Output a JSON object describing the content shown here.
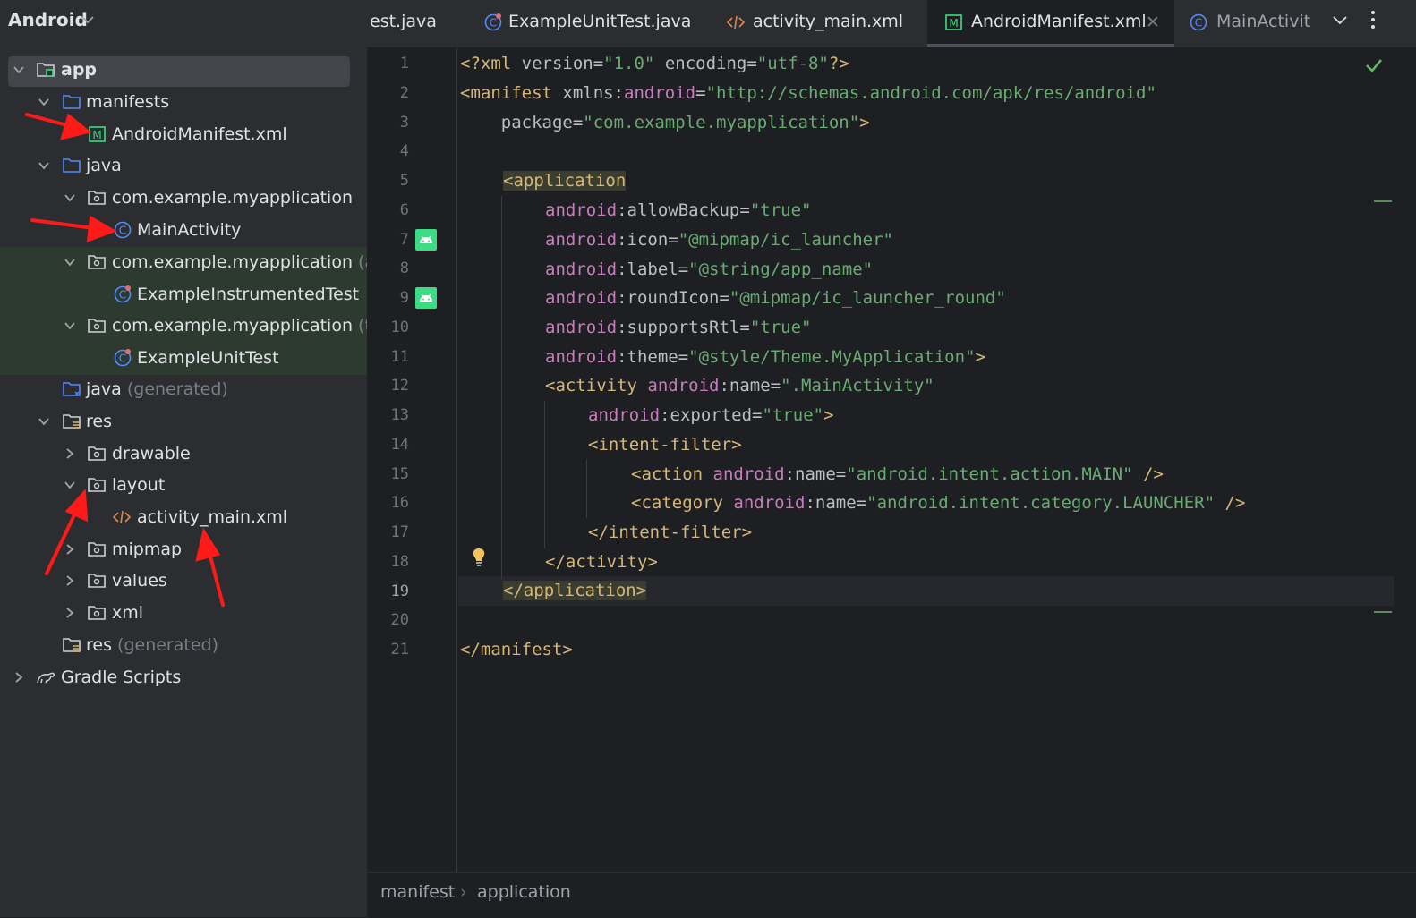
{
  "project_panel": {
    "title": "Android",
    "tree": [
      {
        "label": "app",
        "hint": ""
      },
      {
        "label": "manifests",
        "hint": ""
      },
      {
        "label": "AndroidManifest.xml",
        "hint": ""
      },
      {
        "label": "java",
        "hint": ""
      },
      {
        "label": "com.example.myapplication",
        "hint": ""
      },
      {
        "label": "MainActivity",
        "hint": ""
      },
      {
        "label": "com.example.myapplication",
        "hint": "(and"
      },
      {
        "label": "ExampleInstrumentedTest",
        "hint": ""
      },
      {
        "label": "com.example.myapplication",
        "hint": "(test"
      },
      {
        "label": "ExampleUnitTest",
        "hint": ""
      },
      {
        "label": "java",
        "hint": "(generated)"
      },
      {
        "label": "res",
        "hint": ""
      },
      {
        "label": "drawable",
        "hint": ""
      },
      {
        "label": "layout",
        "hint": ""
      },
      {
        "label": "activity_main.xml",
        "hint": ""
      },
      {
        "label": "mipmap",
        "hint": ""
      },
      {
        "label": "values",
        "hint": ""
      },
      {
        "label": "xml",
        "hint": ""
      },
      {
        "label": "res",
        "hint": "(generated)"
      },
      {
        "label": "Gradle Scripts",
        "hint": ""
      }
    ]
  },
  "tabs": [
    {
      "label": "est.java",
      "icon": "none"
    },
    {
      "label": "ExampleUnitTest.java",
      "icon": "java-class-icon"
    },
    {
      "label": "activity_main.xml",
      "icon": "xml-layout-icon"
    },
    {
      "label": "AndroidManifest.xml",
      "icon": "manifest-icon",
      "active": true
    },
    {
      "label": "MainActivit",
      "icon": "java-class-icon"
    }
  ],
  "editor": {
    "line_numbers": [
      "1",
      "2",
      "3",
      "4",
      "5",
      "6",
      "7",
      "8",
      "9",
      "10",
      "11",
      "12",
      "13",
      "14",
      "15",
      "16",
      "17",
      "18",
      "19",
      "20",
      "21"
    ],
    "current_line": "19",
    "code": {
      "l1": {
        "a": "<?xml ",
        "b": "version",
        "c": "=",
        "d": "\"1.0\"",
        "e": " encoding",
        "f": "=",
        "g": "\"utf-8\"",
        "h": "?>"
      },
      "l2": {
        "a": "<manifest ",
        "b": "xmlns:",
        "c": "android",
        "d": "=",
        "e": "\"http://schemas.android.com/apk/res/android\""
      },
      "l3": {
        "a": "    package",
        "b": "=",
        "c": "\"com.example.myapplication\"",
        "d": ">"
      },
      "l5": {
        "a": "<application"
      },
      "l6": {
        "ns": "android",
        "attr": ":allowBackup",
        "eq": "=",
        "val": "\"true\""
      },
      "l7": {
        "ns": "android",
        "attr": ":icon",
        "eq": "=",
        "val": "\"@mipmap/ic_launcher\""
      },
      "l8": {
        "ns": "android",
        "attr": ":label",
        "eq": "=",
        "val": "\"@string/app_name\""
      },
      "l9": {
        "ns": "android",
        "attr": ":roundIcon",
        "eq": "=",
        "val": "\"@mipmap/ic_launcher_round\""
      },
      "l10": {
        "ns": "android",
        "attr": ":supportsRtl",
        "eq": "=",
        "val": "\"true\""
      },
      "l11": {
        "ns": "android",
        "attr": ":theme",
        "eq": "=",
        "val": "\"@style/Theme.MyApplication\"",
        "end": ">"
      },
      "l12": {
        "tag": "<activity ",
        "ns": "android",
        "attr": ":name",
        "eq": "=",
        "val": "\".MainActivity\""
      },
      "l13": {
        "ns": "android",
        "attr": ":exported",
        "eq": "=",
        "val": "\"true\"",
        "end": ">"
      },
      "l14": {
        "tag": "<intent-filter>"
      },
      "l15": {
        "tag": "<action ",
        "ns": "android",
        "attr": ":name",
        "eq": "=",
        "val": "\"android.intent.action.MAIN\"",
        "end": " />"
      },
      "l16": {
        "tag": "<category ",
        "ns": "android",
        "attr": ":name",
        "eq": "=",
        "val": "\"android.intent.category.LAUNCHER\"",
        "end": " />"
      },
      "l17": {
        "tag": "</intent-filter>"
      },
      "l18": {
        "tag": "</activity>"
      },
      "l19": {
        "tag": "</application>"
      },
      "l21": {
        "tag": "</manifest>"
      }
    }
  },
  "breadcrumb": {
    "items": [
      "manifest",
      "application"
    ],
    "separator": "›"
  },
  "colors": {
    "annotation_arrow": "#ff1a1a",
    "android_green": "#3ddc84"
  }
}
